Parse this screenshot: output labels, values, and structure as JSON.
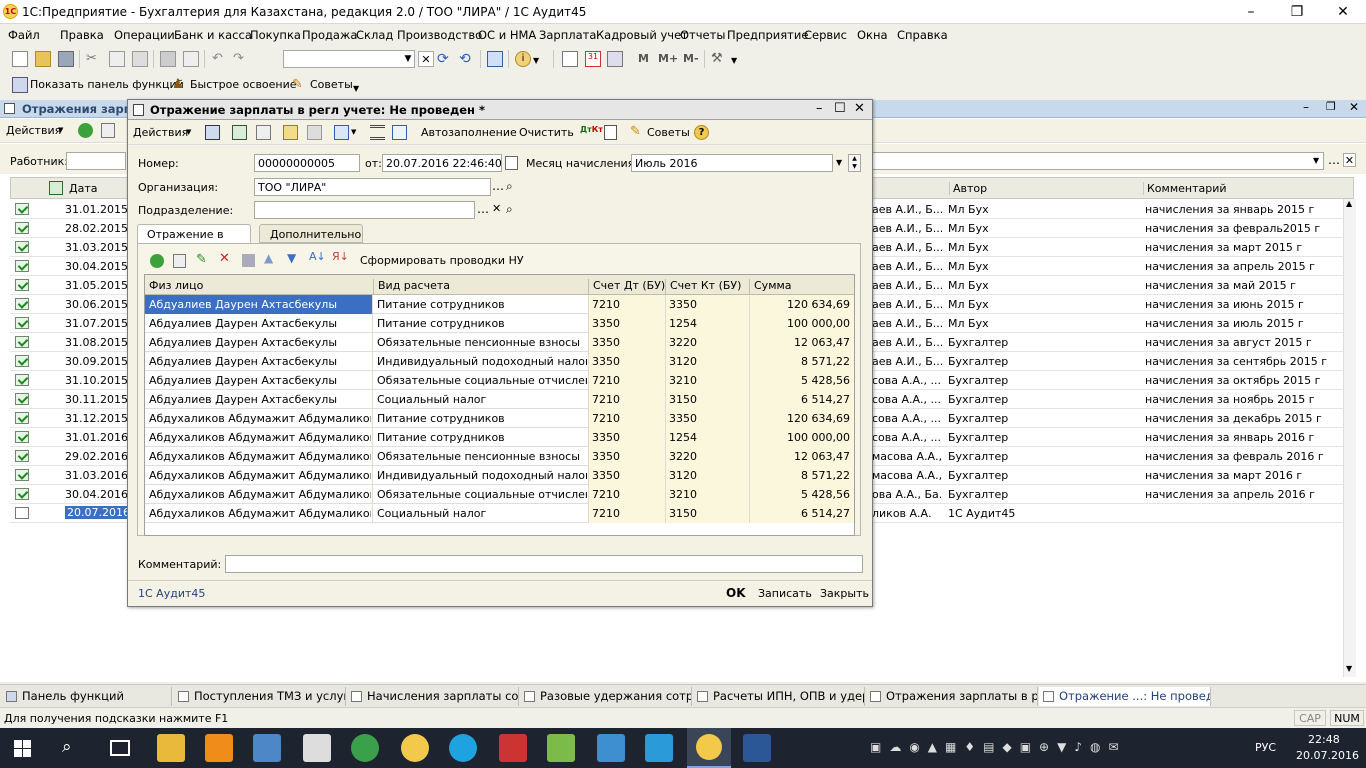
{
  "window": {
    "title": "1С:Предприятие - Бухгалтерия для Казахстана, редакция 2.0 / ТОО \"ЛИРА\" / 1С Аудит45"
  },
  "menu": [
    "Файл",
    "Правка",
    "Операции",
    "Банк и касса",
    "Покупка",
    "Продажа",
    "Склад",
    "Производство",
    "ОС и НМА",
    "Зарплата",
    "Кадровый учет",
    "Отчеты",
    "Предприятие",
    "Сервис",
    "Окна",
    "Справка"
  ],
  "toolbar": {
    "zoom_buttons": [
      "M",
      "M+",
      "M-"
    ],
    "show_panel": "Показать панель функций",
    "quick_start": "Быстрое освоение",
    "tips": "Советы"
  },
  "list": {
    "title": "Отражения зарпла",
    "actions": "Действия",
    "employee_label": "Работник:",
    "columns": [
      "Дата",
      "Автор",
      "Комментарий"
    ],
    "rows": [
      {
        "date": "31.01.2015",
        "name": "аев А.И., Б...",
        "author": "Мл Бух",
        "comment": "начисления за январь 2015 г"
      },
      {
        "date": "28.02.2015",
        "name": "аев А.И., Б...",
        "author": "Мл Бух",
        "comment": "начисления за февраль2015 г"
      },
      {
        "date": "31.03.2015",
        "name": "аев А.И., Б...",
        "author": "Мл Бух",
        "comment": "начисления за  март 2015 г"
      },
      {
        "date": "30.04.2015",
        "name": "аев А.И., Б...",
        "author": "Мл Бух",
        "comment": "начисления за апрель 2015 г"
      },
      {
        "date": "31.05.2015",
        "name": "аев А.И., Б...",
        "author": "Мл Бух",
        "comment": "начисления за май 2015 г"
      },
      {
        "date": "30.06.2015",
        "name": "аев А.И., Б...",
        "author": "Мл Бух",
        "comment": "начисления за июнь 2015 г"
      },
      {
        "date": "31.07.2015",
        "name": "аев А.И., Б...",
        "author": "Мл Бух",
        "comment": "начисления за июль 2015 г"
      },
      {
        "date": "31.08.2015",
        "name": "аев А.И., Б...",
        "author": "Бухгалтер",
        "comment": "начисления за август 2015 г"
      },
      {
        "date": "30.09.2015",
        "name": "аев А.И., Б...",
        "author": "Бухгалтер",
        "comment": "начисления за сентябрь 2015 г"
      },
      {
        "date": "31.10.2015",
        "name": "сова А.А., ...",
        "author": "Бухгалтер",
        "comment": "начисления за октябрь 2015 г"
      },
      {
        "date": "30.11.2015",
        "name": "сова А.А., ...",
        "author": "Бухгалтер",
        "comment": "начисления за ноябрь 2015 г"
      },
      {
        "date": "31.12.2015",
        "name": "сова А.А., ...",
        "author": "Бухгалтер",
        "comment": "начисления за декабрь 2015 г"
      },
      {
        "date": "31.01.2016",
        "name": "сова А.А., ...",
        "author": "Бухгалтер",
        "comment": "начисления за январь 2016 г"
      },
      {
        "date": "29.02.2016",
        "name": "масова А.А., ...",
        "author": "Бухгалтер",
        "comment": "начисления за февраль 2016 г"
      },
      {
        "date": "31.03.2016",
        "name": "масова А.А., Ба...",
        "author": "Бухгалтер",
        "comment": "начисления за март 2016 г"
      },
      {
        "date": "30.04.2016",
        "name": "ова А.А., Ба...",
        "author": "Бухгалтер",
        "comment": "начисления за апрель 2016 г"
      },
      {
        "date": "20.07.2016",
        "name": "ликов А.А.",
        "author": "1С Аудит45",
        "comment": ""
      }
    ]
  },
  "dialog": {
    "title": "Отражение зарплаты в регл учете: Не проведен *",
    "toolbar": {
      "actions": "Действия",
      "autofill": "Автозаполнение",
      "clear": "Очистить",
      "tips": "Советы"
    },
    "number_label": "Номер:",
    "number": "00000000005",
    "from_label": "от:",
    "date": "20.07.2016 22:46:40",
    "month_label": "Месяц начисления:",
    "month": "Июль 2016",
    "org_label": "Организация:",
    "org": "ТОО \"ЛИРА\"",
    "dept_label": "Подразделение:",
    "dept": "",
    "tabs": [
      "Отражение в учете",
      "Дополнительно"
    ],
    "form_postings": "Сформировать проводки НУ",
    "table_columns": [
      "Физ лицо",
      "Вид расчета",
      "Счет Дт (БУ)",
      "Счет Кт (БУ)",
      "Сумма"
    ],
    "rows": [
      {
        "person": "Абдуалиев Даурен Ахтасбекулы",
        "kind": "Питание сотрудников",
        "dt": "7210",
        "kt": "3350",
        "sum": "120 634,69"
      },
      {
        "person": "Абдуалиев Даурен Ахтасбекулы",
        "kind": "Питание сотрудников",
        "dt": "3350",
        "kt": "1254",
        "sum": "100 000,00"
      },
      {
        "person": "Абдуалиев Даурен Ахтасбекулы",
        "kind": "Обязательные пенсионные взносы",
        "dt": "3350",
        "kt": "3220",
        "sum": "12 063,47"
      },
      {
        "person": "Абдуалиев Даурен Ахтасбекулы",
        "kind": "Индивидуальный подоходный налог",
        "dt": "3350",
        "kt": "3120",
        "sum": "8 571,22"
      },
      {
        "person": "Абдуалиев Даурен Ахтасбекулы",
        "kind": "Обязательные социальные отчисления",
        "dt": "7210",
        "kt": "3210",
        "sum": "5 428,56"
      },
      {
        "person": "Абдуалиев Даурен Ахтасбекулы",
        "kind": "Социальный налог",
        "dt": "7210",
        "kt": "3150",
        "sum": "6 514,27"
      },
      {
        "person": "Абдухаликов Абдумажит Абдумаликович",
        "kind": "Питание сотрудников",
        "dt": "7210",
        "kt": "3350",
        "sum": "120 634,69"
      },
      {
        "person": "Абдухаликов Абдумажит Абдумаликович",
        "kind": "Питание сотрудников",
        "dt": "3350",
        "kt": "1254",
        "sum": "100 000,00"
      },
      {
        "person": "Абдухаликов Абдумажит Абдумаликович",
        "kind": "Обязательные пенсионные взносы",
        "dt": "3350",
        "kt": "3220",
        "sum": "12 063,47"
      },
      {
        "person": "Абдухаликов Абдумажит Абдумаликович",
        "kind": "Индивидуальный подоходный налог",
        "dt": "3350",
        "kt": "3120",
        "sum": "8 571,22"
      },
      {
        "person": "Абдухаликов Абдумажит Абдумаликович",
        "kind": "Обязательные социальные отчисления",
        "dt": "7210",
        "kt": "3210",
        "sum": "5 428,56"
      },
      {
        "person": "Абдухаликов Абдумажит Абдумаликович",
        "kind": "Социальный налог",
        "dt": "7210",
        "kt": "3150",
        "sum": "6 514,27"
      }
    ],
    "comment_label": "Комментарий:",
    "author": "1С Аудит45",
    "ok": "OK",
    "save": "Записать",
    "close": "Закрыть"
  },
  "window_tabs": [
    "Панель функций",
    "Поступления ТМЗ и услуг",
    "Начисления зарплаты сотр...",
    "Разовые удержания сотруд...",
    "Расчеты ИПН, ОПВ и удер...",
    "Отражения зарплаты в рег...",
    "Отражение ...: Не проведен *"
  ],
  "status": {
    "hint": "Для получения подсказки нажмите F1",
    "cap": "CAP",
    "num": "NUM"
  },
  "taskbar": {
    "lang": "РУС",
    "time": "22:48",
    "date": "20.07.2016"
  },
  "colors": {
    "accent": "#3a6fc4",
    "dialog_bg": "#f4f2e4",
    "cell_bg": "#fbf7dc",
    "taskbar": "#1d2430"
  }
}
